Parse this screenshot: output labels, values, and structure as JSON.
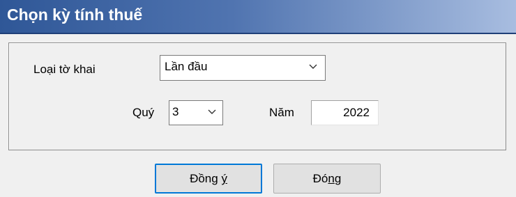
{
  "dialog": {
    "title": "Chọn kỳ tính thuế"
  },
  "form": {
    "declaration_type_label": "Loại tờ khai",
    "declaration_type_value": "Lần đầu",
    "quarter_label": "Quý",
    "quarter_value": "3",
    "year_label": "Năm",
    "year_value": "2022"
  },
  "buttons": {
    "ok_pre": "Đồng ",
    "ok_accel": "ý",
    "close_pre": "Đó",
    "close_accel": "n",
    "close_post": "g"
  },
  "icons": {
    "dropdown": "chevron-down-icon"
  },
  "colors": {
    "title_bar_start": "#2f5797",
    "title_bar_end": "#a8bde0",
    "default_button_border": "#0078d7"
  }
}
